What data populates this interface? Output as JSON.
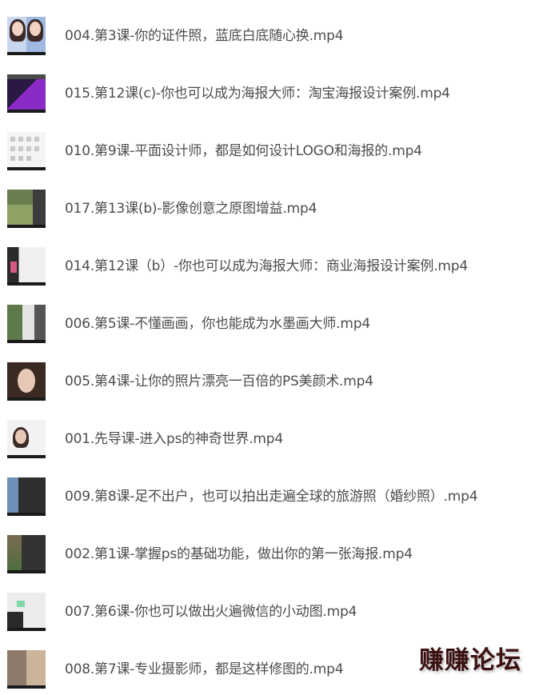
{
  "files": [
    {
      "name": "004.第3课-你的证件照，蓝底白底随心换.mp4"
    },
    {
      "name": "015.第12课(c)-你也可以成为海报大师：淘宝海报设计案例.mp4"
    },
    {
      "name": "010.第9课-平面设计师，都是如何设计LOGO和海报的.mp4"
    },
    {
      "name": "017.第13课(b)-影像创意之原图增益.mp4"
    },
    {
      "name": "014.第12课（b）-你也可以成为海报大师：商业海报设计案例.mp4"
    },
    {
      "name": "006.第5课-不懂画画，你也能成为水墨画大师.mp4"
    },
    {
      "name": "005.第4课-让你的照片漂亮一百倍的PS美颜术.mp4"
    },
    {
      "name": "001.先导课-进入ps的神奇世界.mp4"
    },
    {
      "name": "009.第8课-足不出户，也可以拍出走遍全球的旅游照（婚纱照）.mp4"
    },
    {
      "name": "002.第1课-掌握ps的基础功能，做出你的第一张海报.mp4"
    },
    {
      "name": "007.第6课-你也可以做出火遍微信的小动图.mp4"
    },
    {
      "name": "008.第7课-专业摄影师，都是这样修图的.mp4"
    }
  ],
  "watermark": {
    "text": "赚赚论坛"
  },
  "colors": {
    "text": "#4d4d4d",
    "background": "#ffffff",
    "watermark": "#3a1010"
  }
}
